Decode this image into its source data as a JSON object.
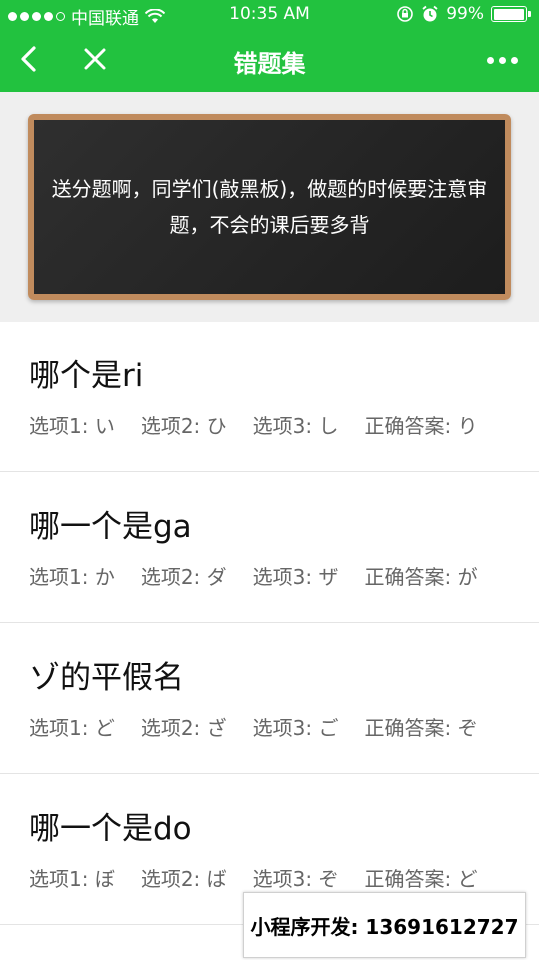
{
  "status_bar": {
    "carrier": "中国联通",
    "time": "10:35 AM",
    "battery": "99%",
    "battery_level": 0.99
  },
  "nav": {
    "title": "错题集",
    "back_icon": "chevron-left-icon",
    "close_icon": "close-icon",
    "more_icon": "more-dots-icon"
  },
  "blackboard": {
    "text": "送分题啊，同学们(敲黑板)，做题的时候要注意审题，不会的课后要多背"
  },
  "questions": [
    {
      "question": "哪个是ri",
      "option1": "选项1: い",
      "option2": "选项2: ひ",
      "option3": "选项3: し",
      "answer": "正确答案: り"
    },
    {
      "question": "哪一个是ga",
      "option1": "选项1: か",
      "option2": "选项2: ダ",
      "option3": "选项3: ザ",
      "answer": "正确答案: が"
    },
    {
      "question": "ゾ的平假名",
      "option1": "选项1: ど",
      "option2": "选项2: ざ",
      "option3": "选项3: ご",
      "answer": "正确答案: ぞ"
    },
    {
      "question": "哪一个是do",
      "option1": "选项1: ぼ",
      "option2": "选项2: ば",
      "option3": "选项3: ぞ",
      "answer": "正确答案: ど"
    }
  ],
  "watermark": "小程序开发: 13691612727",
  "colors": {
    "brand_green": "#22c23f",
    "board_frame": "#c08b5d",
    "board": "#262626"
  }
}
